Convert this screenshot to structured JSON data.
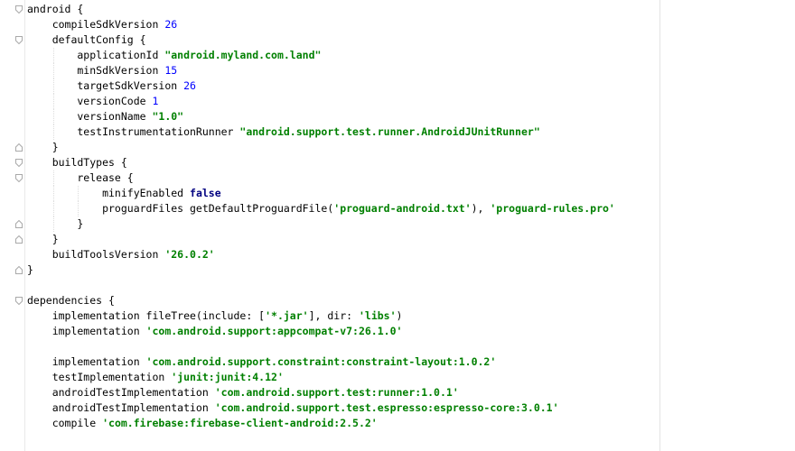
{
  "editor": {
    "lines": [
      [
        {
          "t": "android {"
        }
      ],
      [
        {
          "t": "    compileSdkVersion "
        },
        {
          "t": "26",
          "c": "num"
        }
      ],
      [
        {
          "t": "    defaultConfig {"
        }
      ],
      [
        {
          "t": "        applicationId "
        },
        {
          "t": "\"android.myland.com.land\"",
          "c": "str"
        }
      ],
      [
        {
          "t": "        minSdkVersion "
        },
        {
          "t": "15",
          "c": "num"
        }
      ],
      [
        {
          "t": "        targetSdkVersion "
        },
        {
          "t": "26",
          "c": "num"
        }
      ],
      [
        {
          "t": "        versionCode "
        },
        {
          "t": "1",
          "c": "num"
        }
      ],
      [
        {
          "t": "        versionName "
        },
        {
          "t": "\"1.0\"",
          "c": "str"
        }
      ],
      [
        {
          "t": "        testInstrumentationRunner "
        },
        {
          "t": "\"android.support.test.runner.AndroidJUnitRunner\"",
          "c": "str"
        }
      ],
      [
        {
          "t": "    }"
        }
      ],
      [
        {
          "t": "    buildTypes {"
        }
      ],
      [
        {
          "t": "        release {"
        }
      ],
      [
        {
          "t": "            minifyEnabled "
        },
        {
          "t": "false",
          "c": "kw"
        }
      ],
      [
        {
          "t": "            proguardFiles getDefaultProguardFile("
        },
        {
          "t": "'proguard-android.txt'",
          "c": "str"
        },
        {
          "t": "), "
        },
        {
          "t": "'proguard-rules.pro'",
          "c": "str"
        }
      ],
      [
        {
          "t": "        }"
        }
      ],
      [
        {
          "t": "    }"
        }
      ],
      [
        {
          "t": "    buildToolsVersion "
        },
        {
          "t": "'26.0.2'",
          "c": "str"
        }
      ],
      [
        {
          "t": "}"
        }
      ],
      [
        {
          "t": ""
        }
      ],
      [
        {
          "t": "dependencies {"
        }
      ],
      [
        {
          "t": "    implementation fileTree(include: ["
        },
        {
          "t": "'*.jar'",
          "c": "str"
        },
        {
          "t": "], dir: "
        },
        {
          "t": "'libs'",
          "c": "str"
        },
        {
          "t": ")"
        }
      ],
      [
        {
          "t": "    implementation "
        },
        {
          "t": "'com.android.support:appcompat-v7:26.1.0'",
          "c": "str"
        }
      ],
      [
        {
          "t": ""
        }
      ],
      [
        {
          "t": "    implementation "
        },
        {
          "t": "'com.android.support.constraint:constraint-layout:1.0.2'",
          "c": "str"
        }
      ],
      [
        {
          "t": "    testImplementation "
        },
        {
          "t": "'junit:junit:4.12'",
          "c": "str"
        }
      ],
      [
        {
          "t": "    androidTestImplementation "
        },
        {
          "t": "'com.android.support.test:runner:1.0.1'",
          "c": "str"
        }
      ],
      [
        {
          "t": "    androidTestImplementation "
        },
        {
          "t": "'com.android.support.test.espresso:espresso-core:3.0.1'",
          "c": "str"
        }
      ],
      [
        {
          "t": "    compile "
        },
        {
          "t": "'com.firebase:firebase-client-android:2.5.2'",
          "c": "str"
        }
      ]
    ],
    "fold_markers": [
      {
        "line": 0,
        "kind": "open"
      },
      {
        "line": 2,
        "kind": "open"
      },
      {
        "line": 9,
        "kind": "close"
      },
      {
        "line": 10,
        "kind": "open"
      },
      {
        "line": 11,
        "kind": "open"
      },
      {
        "line": 14,
        "kind": "close"
      },
      {
        "line": 15,
        "kind": "close"
      },
      {
        "line": 17,
        "kind": "close"
      },
      {
        "line": 19,
        "kind": "open"
      }
    ],
    "colors": {
      "string": "#008000",
      "number": "#0000ff",
      "keyword": "#000080",
      "text": "#000000"
    }
  }
}
